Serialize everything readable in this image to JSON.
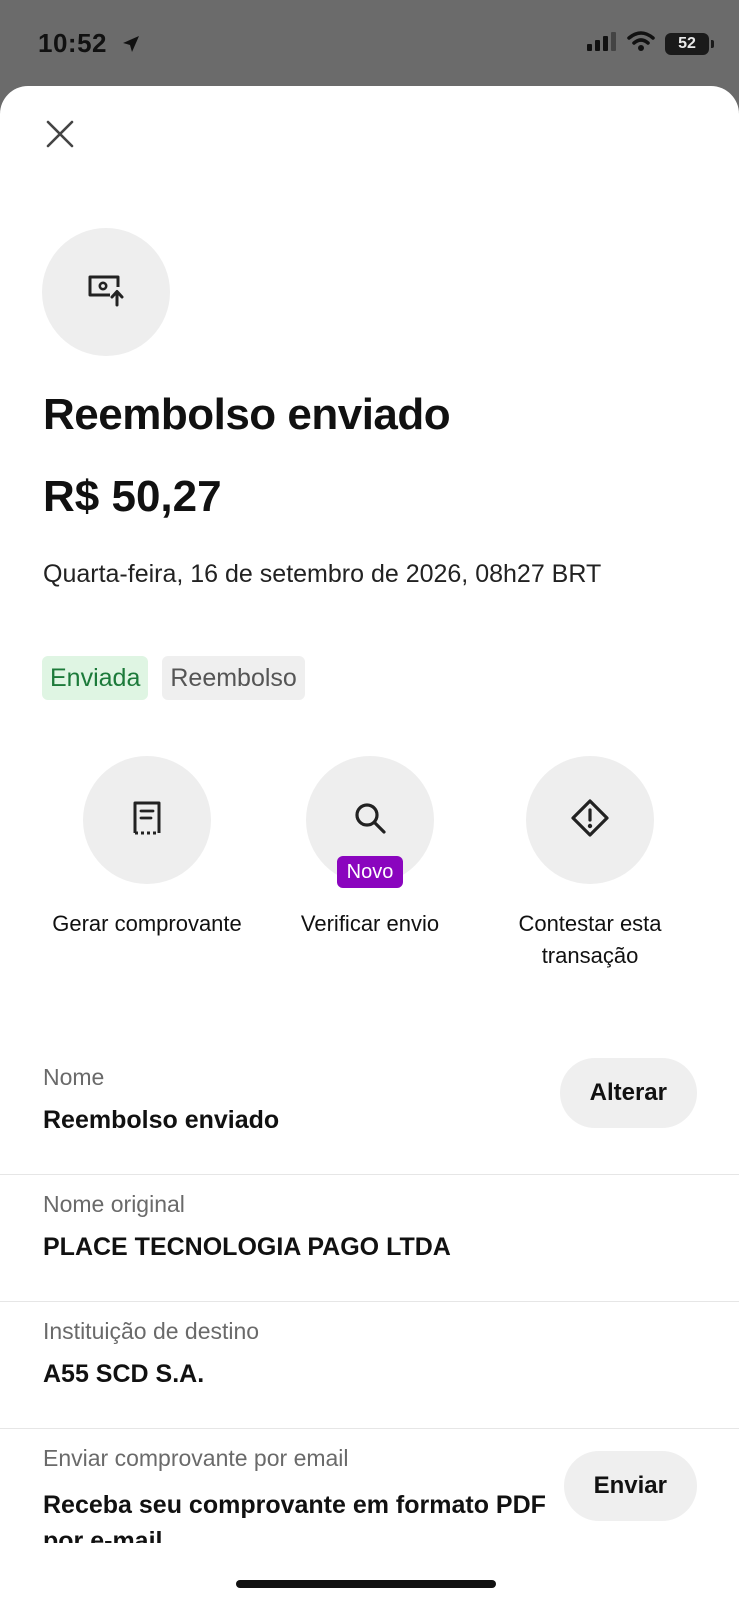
{
  "status_bar": {
    "time": "10:52",
    "battery": "52"
  },
  "transaction": {
    "title": "Reembolso enviado",
    "amount": "R$ 50,27",
    "date": "Quarta-feira, 16 de setembro de 2026, 08h27 BRT",
    "chips": [
      "Enviada",
      "Reembolso"
    ]
  },
  "actions": [
    {
      "label": "Gerar comprovante"
    },
    {
      "label": "Verificar envio",
      "badge": "Novo"
    },
    {
      "label": "Contestar esta transação"
    }
  ],
  "details": {
    "name": {
      "label": "Nome",
      "value": "Reembolso enviado",
      "button": "Alterar"
    },
    "original_name": {
      "label": "Nome original",
      "value": "PLACE TECNOLOGIA PAGO LTDA"
    },
    "institution": {
      "label": "Instituição de destino",
      "value": "A55 SCD S.A."
    },
    "email": {
      "label": "Enviar comprovante por email",
      "value": "Receba seu comprovante em formato PDF por e-mail",
      "button": "Enviar"
    }
  },
  "colors": {
    "chip_sent_bg": "#dff5e3",
    "chip_sent_text": "#1c7a3a",
    "badge_new": "#8a05be"
  },
  "icons": [
    "close-icon",
    "money-send-icon",
    "receipt-icon",
    "search-icon",
    "warning-diamond-icon",
    "location-arrow-icon",
    "signal-icon",
    "wifi-icon",
    "battery-icon"
  ]
}
